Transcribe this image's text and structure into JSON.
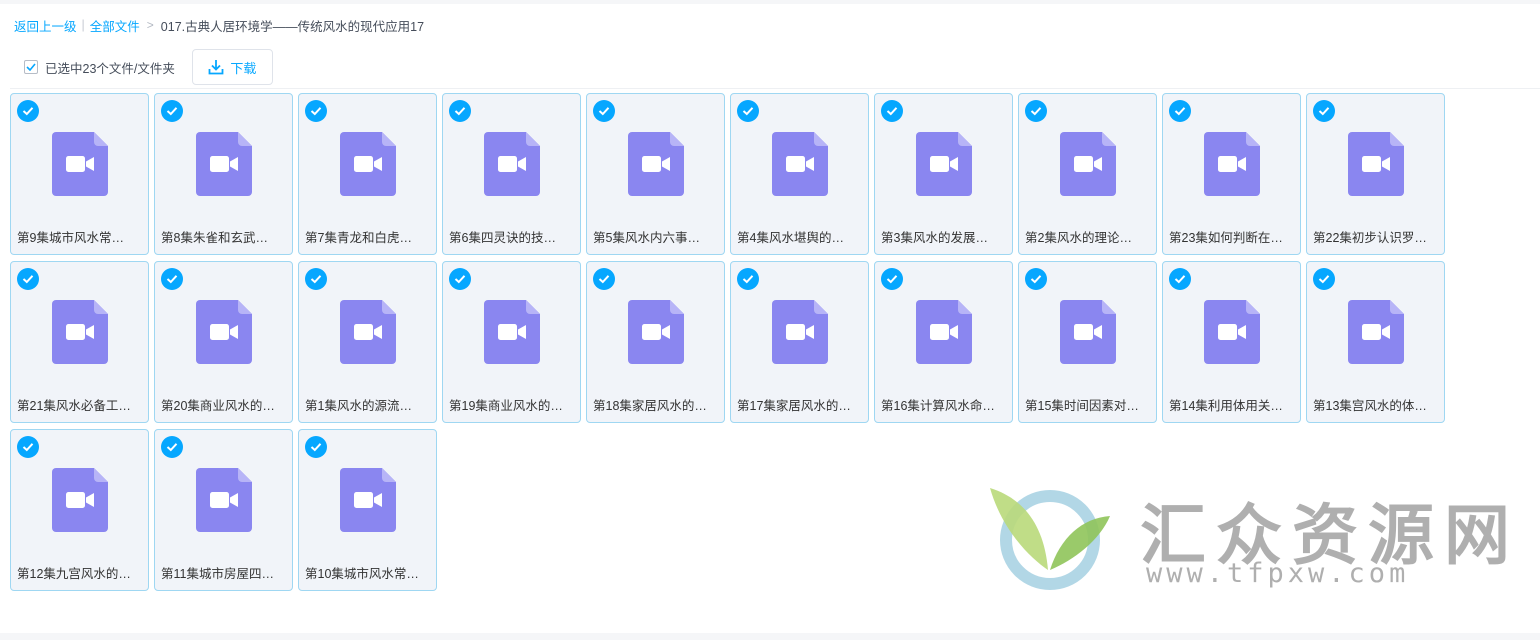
{
  "breadcrumb": {
    "back": "返回上一级",
    "all_files": "全部文件",
    "current": "017.古典人居环境学——传统风水的现代应用17"
  },
  "toolbar": {
    "selected_text": "已选中23个文件/文件夹",
    "download_label": "下载"
  },
  "files": [
    {
      "name": "第9集城市风水常…"
    },
    {
      "name": "第8集朱雀和玄武…"
    },
    {
      "name": "第7集青龙和白虎…"
    },
    {
      "name": "第6集四灵诀的技…"
    },
    {
      "name": "第5集风水内六事…"
    },
    {
      "name": "第4集风水堪舆的…"
    },
    {
      "name": "第3集风水的发展…"
    },
    {
      "name": "第2集风水的理论…"
    },
    {
      "name": "第23集如何判断在…"
    },
    {
      "name": "第22集初步认识罗…"
    },
    {
      "name": "第21集风水必备工…"
    },
    {
      "name": "第20集商业风水的…"
    },
    {
      "name": "第1集风水的源流…"
    },
    {
      "name": "第19集商业风水的…"
    },
    {
      "name": "第18集家居风水的…"
    },
    {
      "name": "第17集家居风水的…"
    },
    {
      "name": "第16集计算风水命…"
    },
    {
      "name": "第15集时间因素对…"
    },
    {
      "name": "第14集利用体用关…"
    },
    {
      "name": "第13集宫风水的体…"
    },
    {
      "name": "第12集九宫风水的…"
    },
    {
      "name": "第11集城市房屋四…"
    },
    {
      "name": "第10集城市风水常…"
    }
  ],
  "watermark": {
    "title": "汇众资源网",
    "url": "www.tfpxw.com"
  },
  "colors": {
    "accent": "#06a7ff",
    "video_icon": "#8a86f0",
    "card_bg": "#f1f4f9",
    "card_border": "#9fd7f2"
  }
}
